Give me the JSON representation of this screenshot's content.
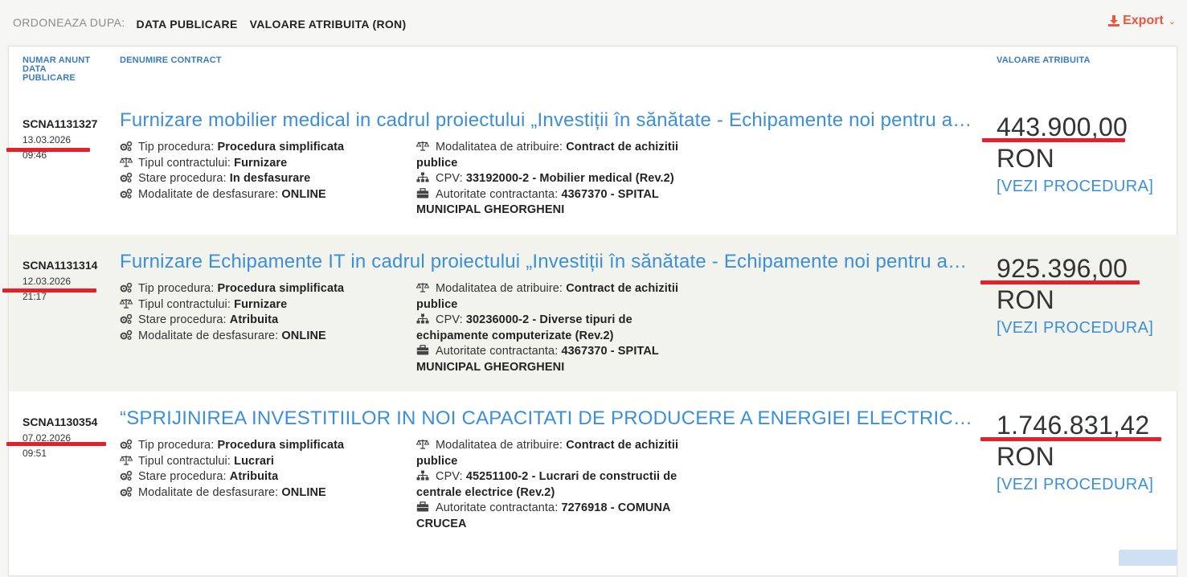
{
  "sort": {
    "label": "ORDONEAZA DUPA:",
    "options": [
      "DATA PUBLICARE",
      "VALOARE ATRIBUITA (RON)"
    ]
  },
  "export": {
    "label": "Export"
  },
  "headers": {
    "num": "NUMAR ANUNT",
    "date1": "DATA",
    "date2": "PUBLICARE",
    "name": "DENUMIRE CONTRACT",
    "value": "VALOARE ATRIBUITA"
  },
  "labels": {
    "tip": "Tip procedura: ",
    "tipul": "Tipul contractului: ",
    "stare": "Stare procedura: ",
    "mod_desf": "Modalitate de desfasurare: ",
    "mod_atr": "Modalitatea de atribuire: ",
    "cpv": "CPV: ",
    "autoritate": "Autoritate contractanta: ",
    "vezi": "[VEZI PROCEDURA]"
  },
  "rows": [
    {
      "num": "SCNA1131327",
      "date": "13.03.2026",
      "time": "09:46",
      "title": "Furnizare mobilier medical in cadrul proiectului „Investiții în sănătate - Echipamente noi pentru ambulatoriul Spitalului Municipal Gheorgheni”",
      "tip": "Procedura simplificata",
      "tipul": "Furnizare",
      "stare": "In desfasurare",
      "mod_desf": "ONLINE",
      "mod_atr": "Contract de achizitii publice",
      "cpv": "33192000-2 - Mobilier medical (Rev.2)",
      "autoritate": "4367370 - SPITAL MUNICIPAL GHEORGHENI",
      "value": "443.900,00",
      "currency": "RON"
    },
    {
      "num": "SCNA1131314",
      "date": "12.03.2026",
      "time": "21:17",
      "title": "Furnizare Echipamente IT in cadrul proiectului „Investiții în sănătate - Echipamente noi pentru ambulatoriul Spitalului Municipal Gheorgheni”",
      "tip": "Procedura simplificata",
      "tipul": "Furnizare",
      "stare": "Atribuita",
      "mod_desf": "ONLINE",
      "mod_atr": "Contract de achizitii publice",
      "cpv": "30236000-2 - Diverse tipuri de echipamente computerizate (Rev.2)",
      "autoritate": "4367370 - SPITAL MUNICIPAL GHEORGHENI",
      "value": "925.396,00",
      "currency": "RON"
    },
    {
      "num": "SCNA1130354",
      "date": "07.02.2026",
      "time": "09:51",
      "title": "“SPRIJINIREA INVESTITIILOR IN NOI CAPACITATI DE PRODUCERE A ENERGIEI ELECTRICE PRODUSA DIN SURSE REGENERABILE”",
      "tip": "Procedura simplificata",
      "tipul": "Lucrari",
      "stare": "Atribuita",
      "mod_desf": "ONLINE",
      "mod_atr": "Contract de achizitii publice",
      "cpv": "45251100-2 - Lucrari de constructii de centrale electrice (Rev.2)",
      "autoritate": "7276918 - COMUNA CRUCEA",
      "value": "1.746.831,42",
      "currency": "RON"
    }
  ],
  "colors": {
    "link": "#3b8fd8",
    "header": "#3a7abf",
    "export": "#e8573f",
    "annotation": "#e6202a",
    "row_alt": "#f3f3ee"
  }
}
